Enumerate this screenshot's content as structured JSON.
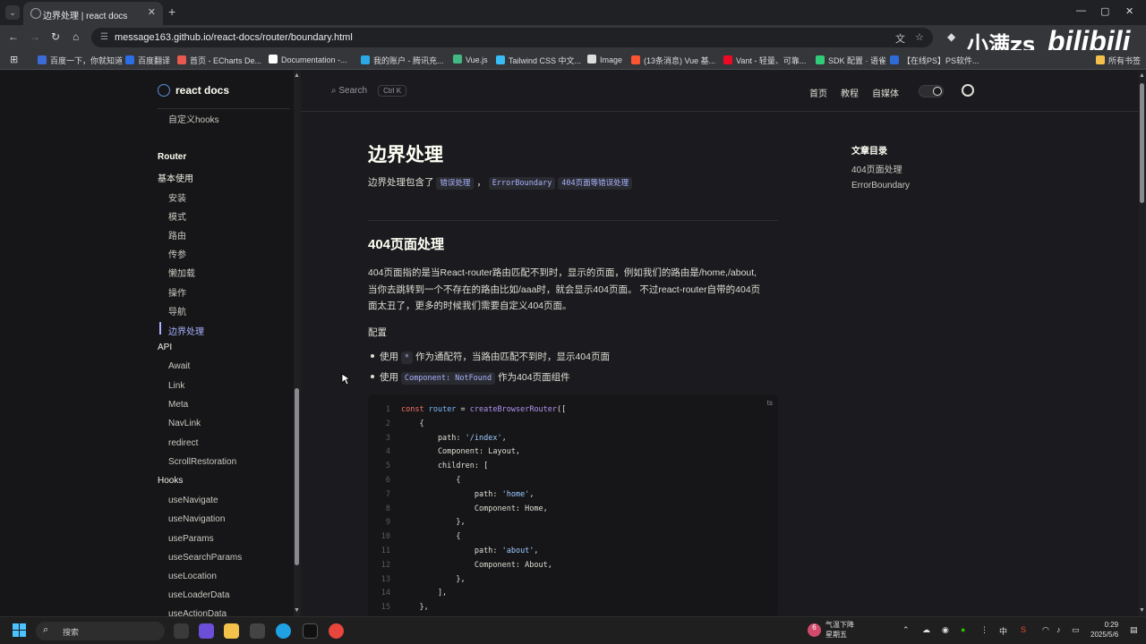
{
  "browser": {
    "tab_title": "边界处理 | react docs",
    "url": "message163.github.io/react-docs/router/boundary.html",
    "new_tab": "+",
    "watermark": "小满zs",
    "watermark_logo": "bilibili"
  },
  "bookmarks": [
    {
      "label": "百度一下，你就知道",
      "color": "#3d6bd6"
    },
    {
      "label": "百度翻译",
      "color": "#2b6fe6"
    },
    {
      "label": "首页 - ECharts De...",
      "color": "#e85a4f"
    },
    {
      "label": "Documentation -...",
      "color": "#ffffff"
    },
    {
      "label": "我的账户 - 腾讯充...",
      "color": "#2aa8e8"
    },
    {
      "label": "Vue.js",
      "color": "#42b883"
    },
    {
      "label": "Tailwind CSS 中文...",
      "color": "#38bdf8"
    },
    {
      "label": "Image",
      "color": "#dddddd"
    },
    {
      "label": "(13条消息) Vue 基...",
      "color": "#fc5531"
    },
    {
      "label": "Vant - 轻量、可靠...",
      "color": "#ee0a24"
    },
    {
      "label": "SDK 配置 · 语雀",
      "color": "#31cc79"
    },
    {
      "label": "【在线PS】PS软件...",
      "color": "#2c6bd8"
    },
    {
      "label": "所有书签",
      "color": "#f5c04a"
    }
  ],
  "site": {
    "logo": "react docs",
    "search": "Search",
    "search_kbd": "Ctrl K",
    "nav": [
      "首页",
      "教程",
      "自媒体"
    ]
  },
  "sidebar": {
    "top_item": "自定义hooks",
    "router_group": "Router",
    "basic_head": "基本使用",
    "basic_items": [
      "安装",
      "模式",
      "路由",
      "传参",
      "懒加载",
      "操作",
      "导航",
      "边界处理"
    ],
    "api_head": "API",
    "api_items": [
      "Await",
      "Link",
      "Meta",
      "NavLink",
      "redirect",
      "ScrollRestoration"
    ],
    "hooks_head": "Hooks",
    "hooks_items": [
      "useNavigate",
      "useNavigation",
      "useParams",
      "useSearchParams",
      "useLocation",
      "useLoaderData",
      "useActionData"
    ]
  },
  "content": {
    "title": "边界处理",
    "intro_prefix": "边界处理包含了",
    "intro_tag1": "错误处理",
    "intro_sep": "，",
    "intro_tag2": "ErrorBoundary",
    "intro_tag3": "404页面等错误处理",
    "section_title": "404页面处理",
    "para_line1": "404页面指的是当React-router路由匹配不到时，显示的页面，例如我们的路由是/home,/about,",
    "para_line2": "当你去跳转到一个不存在的路由比如/aaa时，就会显示404页面。 不过react-router自带的404页",
    "para_line3": "面太丑了，更多的时候我们需要自定义404页面。",
    "config_label": "配置",
    "bullet1_prefix": "使用",
    "bullet1_code": "*",
    "bullet1_suffix": "作为通配符，当路由匹配不到时，显示404页面",
    "bullet2_prefix": "使用",
    "bullet2_code": "Component: NotFound",
    "bullet2_suffix": "作为404页面组件",
    "code_lang": "ts",
    "code_lines": [
      "const router = createBrowserRouter([",
      "    {",
      "        path: '/index',",
      "        Component: Layout,",
      "        children: [",
      "            {",
      "                path: 'home',",
      "                Component: Home,",
      "            },",
      "            {",
      "                path: 'about',",
      "                Component: About,",
      "            },",
      "        ],",
      "    },"
    ]
  },
  "outline": {
    "head": "文章目录",
    "items": [
      "404页面处理",
      "ErrorBoundary"
    ]
  },
  "taskbar": {
    "search": "搜索",
    "weather_badge": "6",
    "weather_line1": "气温下降",
    "weather_line2": "星期五",
    "ime": "中",
    "time": "0:29",
    "date": "2025/5/6"
  }
}
